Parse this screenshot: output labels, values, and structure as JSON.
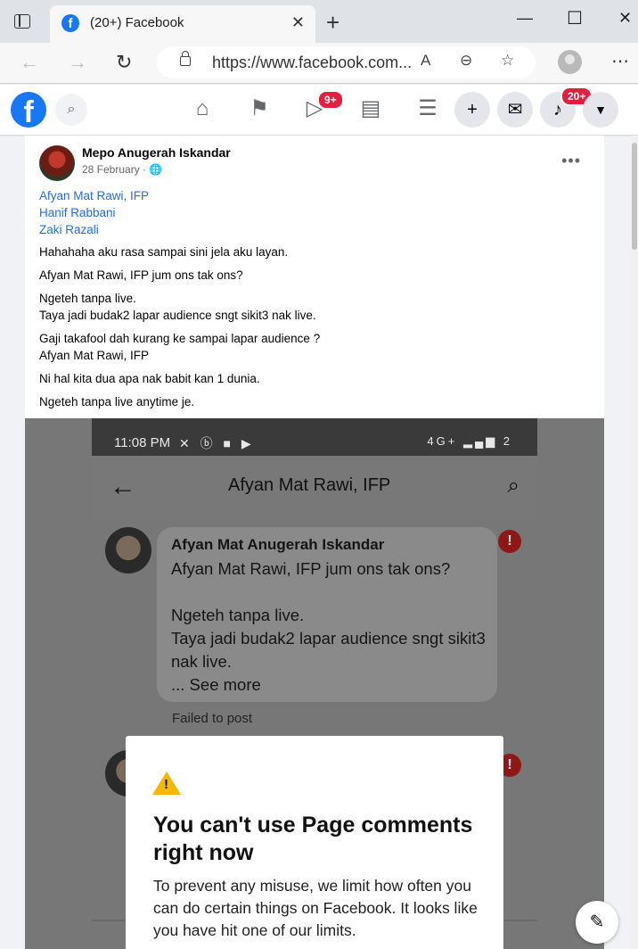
{
  "browser": {
    "tab_title": "(20+) Facebook",
    "tab_favicon": "f",
    "tab_close": "✕",
    "new_tab": "+",
    "url": "https://www.facebook.com...",
    "window_controls": {
      "minimize": "—",
      "maximize": "☐",
      "close": "✕"
    },
    "menu": "⋯"
  },
  "fb_nav": {
    "logo": "f",
    "watch_badge": "9+",
    "notifications_badge": "20+",
    "icons": [
      "home-icon",
      "pages-flag-icon",
      "watch-icon",
      "marketplace-icon",
      "menu-icon",
      "create-icon",
      "messenger-icon",
      "notifications-icon",
      "account-dropdown-icon"
    ]
  },
  "post": {
    "author": "Mepo Anugerah Iskandar",
    "date": "28 February · 🌐",
    "more": "•••",
    "tagged": [
      "Afyan Mat Rawi, IFP",
      "Hanif Rabbani",
      "Zaki Razali"
    ],
    "paragraphs": [
      "Hahahaha aku rasa sampai sini jela aku layan.",
      "Afyan Mat Rawi, IFP jum ons tak ons?",
      "Ngeteh tanpa live.\nTaya jadi budak2 lapar audience sngt sikit3 nak live.",
      "Gaji takafool dah kurang ke sampai lapar audience ?\nAfyan Mat Rawi, IFP",
      "Ni hal kita dua apa nak babit kan 1 dunia.",
      "Ngeteh tanpa live anytime je."
    ]
  },
  "screenshot": {
    "status_time": "11:08 PM",
    "status_icons": "✕ ⓑ ■ ▶",
    "status_right": "4G+ ▂▄▆ 2",
    "header_title": "Afyan Mat Rawi, IFP",
    "back": "←",
    "search": "⌕",
    "comment_author": "Afyan Mat Anugerah Iskandar",
    "comment_text": "Afyan Mat Rawi, IFP jum ons tak ons?\n\nNgeteh tanpa live.\nTaya jadi budak2 lapar audience sngt sikit3 nak live.\n... See more",
    "failed": "Failed to post",
    "error_mark": "!",
    "dialog_title": "You can't use Page comments right now",
    "dialog_body": "To prevent any misuse, we limit how often you can do certain things on Facebook. It looks like you have hit one of our limits."
  },
  "compose_icon": "✎",
  "colors": {
    "fb_blue": "#1877f2",
    "badge_red": "#e41e3f",
    "link": "#216fdb",
    "warning": "#f5b800"
  }
}
